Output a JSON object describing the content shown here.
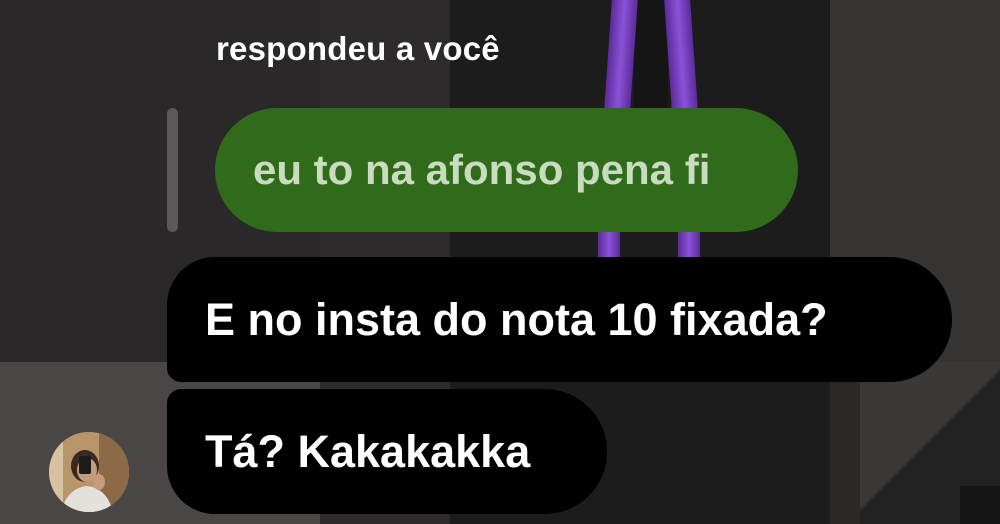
{
  "thread": {
    "reply_header": "respondeu a você",
    "quoted_message": "eu to na afonso pena fi"
  },
  "messages": [
    {
      "text": "E no insta do nota 10 fixada?"
    },
    {
      "text": "Tá? Kakakakka"
    }
  ],
  "colors": {
    "quoted_bubble": "#2f6b1a",
    "quoted_text": "#c9dcbf",
    "message_bubble": "#000000",
    "message_text": "#ffffff",
    "accent_purple": "#8a52d6"
  },
  "avatar": {
    "icon": "user-photo-avatar"
  }
}
